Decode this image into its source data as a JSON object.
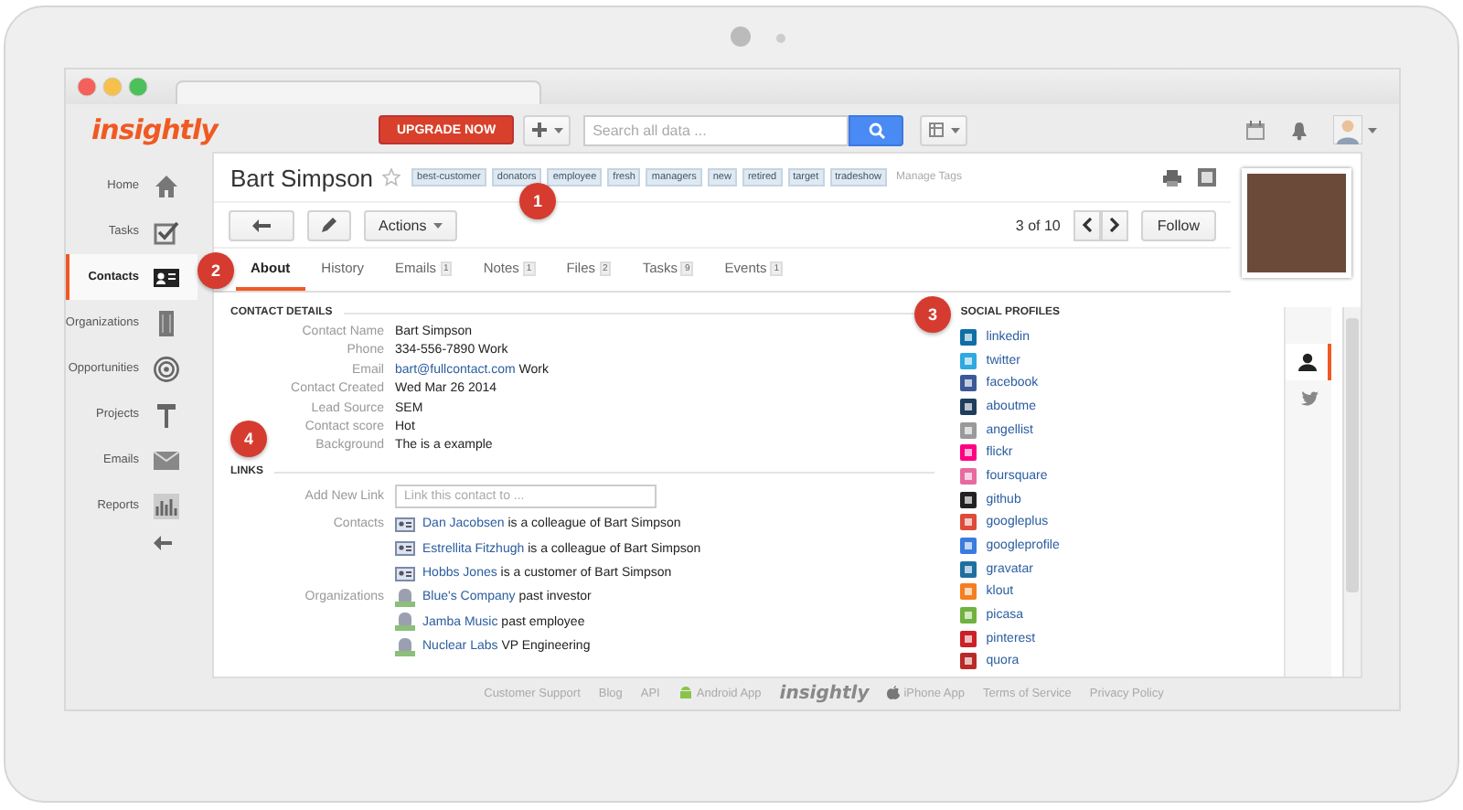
{
  "header": {
    "logo": "insightly",
    "upgrade_button": "UPGRADE NOW",
    "search": {
      "placeholder": "Search all data ..."
    }
  },
  "sidebar": {
    "items": [
      {
        "label": "Home",
        "kind": "home",
        "selected": false
      },
      {
        "label": "Tasks",
        "kind": "tasks",
        "selected": false
      },
      {
        "label": "Contacts",
        "kind": "contacts",
        "selected": true
      },
      {
        "label": "Organizations",
        "kind": "organizations",
        "selected": false
      },
      {
        "label": "Opportunities",
        "kind": "opportunities",
        "selected": false
      },
      {
        "label": "Projects",
        "kind": "projects",
        "selected": false
      },
      {
        "label": "Emails",
        "kind": "emails",
        "selected": false
      },
      {
        "label": "Reports",
        "kind": "reports",
        "selected": false
      }
    ]
  },
  "contact": {
    "name": "Bart Simpson",
    "starred": false,
    "tags": [
      "best-customer",
      "donators",
      "employee",
      "fresh",
      "managers",
      "new",
      "retired",
      "target",
      "tradeshow"
    ],
    "manage_tags": "Manage Tags",
    "actions_button": "Actions",
    "pager": "3 of 10",
    "follow_button": "Follow"
  },
  "tabs": [
    {
      "label": "About",
      "selected": true
    },
    {
      "label": "History",
      "selected": false
    },
    {
      "label": "Emails",
      "count": "1",
      "selected": false
    },
    {
      "label": "Notes",
      "count": "1",
      "selected": false
    },
    {
      "label": "Files",
      "count": "2",
      "selected": false
    },
    {
      "label": "Tasks",
      "count": "9",
      "selected": false
    },
    {
      "label": "Events",
      "count": "1",
      "selected": false
    }
  ],
  "contact_details": {
    "heading": "CONTACT DETAILS",
    "fields": [
      {
        "label": "Contact Name",
        "value": "Bart Simpson"
      },
      {
        "label": "Phone",
        "value": "334-556-7890 Work"
      },
      {
        "label": "Email",
        "kind": "link",
        "link": "bart@fullcontact.com",
        "value": "Work"
      },
      {
        "label": "Contact Created",
        "value": "Wed Mar 26 2014"
      },
      {
        "label": "Lead Source",
        "value": "SEM"
      },
      {
        "label": "Contact score",
        "value": "Hot"
      },
      {
        "label": "Background",
        "value": "The is a example"
      }
    ]
  },
  "links": {
    "heading": "LINKS",
    "add_label": "Add New Link",
    "add_placeholder": "Link this contact to ...",
    "groups": [
      {
        "label": "Contacts",
        "kind": "contact",
        "items": [
          {
            "name": "Dan Jacobsen",
            "relation": "is a colleague of Bart Simpson"
          },
          {
            "name": "Estrellita Fitzhugh",
            "relation": "is a colleague of Bart Simpson"
          },
          {
            "name": "Hobbs Jones",
            "relation": "is a customer of Bart Simpson"
          }
        ]
      },
      {
        "label": "Organizations",
        "kind": "organization",
        "items": [
          {
            "name": "Blue's Company",
            "relation": "past investor"
          },
          {
            "name": "Jamba Music",
            "relation": "past employee"
          },
          {
            "name": "Nuclear Labs",
            "relation": "VP Engineering"
          }
        ]
      }
    ]
  },
  "social_profiles": {
    "heading": "SOCIAL PROFILES",
    "items": [
      {
        "name": "linkedin",
        "color": "#0e6fa6"
      },
      {
        "name": "twitter",
        "color": "#2fa9e0"
      },
      {
        "name": "facebook",
        "color": "#3b5998"
      },
      {
        "name": "aboutme",
        "color": "#1f3d5c"
      },
      {
        "name": "angellist",
        "color": "#9a9a9a"
      },
      {
        "name": "flickr",
        "color": "#ff0084"
      },
      {
        "name": "foursquare",
        "color": "#e86aa0"
      },
      {
        "name": "github",
        "color": "#222222"
      },
      {
        "name": "googleplus",
        "color": "#dd4b39"
      },
      {
        "name": "googleprofile",
        "color": "#3a7be0"
      },
      {
        "name": "gravatar",
        "color": "#1e6fa0"
      },
      {
        "name": "klout",
        "color": "#f47e20"
      },
      {
        "name": "picasa",
        "color": "#6fb23e"
      },
      {
        "name": "pinterest",
        "color": "#cb2027"
      },
      {
        "name": "quora",
        "color": "#b92b27"
      }
    ]
  },
  "side_tabs": [
    {
      "kind": "person",
      "selected": true
    },
    {
      "kind": "twitter",
      "selected": false
    }
  ],
  "footer": {
    "items": [
      {
        "kind": "link",
        "label": "Customer Support"
      },
      {
        "kind": "link",
        "label": "Blog"
      },
      {
        "kind": "link",
        "label": "API"
      },
      {
        "kind": "android",
        "label": "Android App"
      },
      {
        "kind": "logo",
        "label": "insightly"
      },
      {
        "kind": "apple",
        "label": "iPhone App"
      },
      {
        "kind": "link",
        "label": "Terms of Service"
      },
      {
        "kind": "link",
        "label": "Privacy Policy"
      }
    ]
  },
  "annotations": [
    "1",
    "2",
    "3",
    "4"
  ]
}
